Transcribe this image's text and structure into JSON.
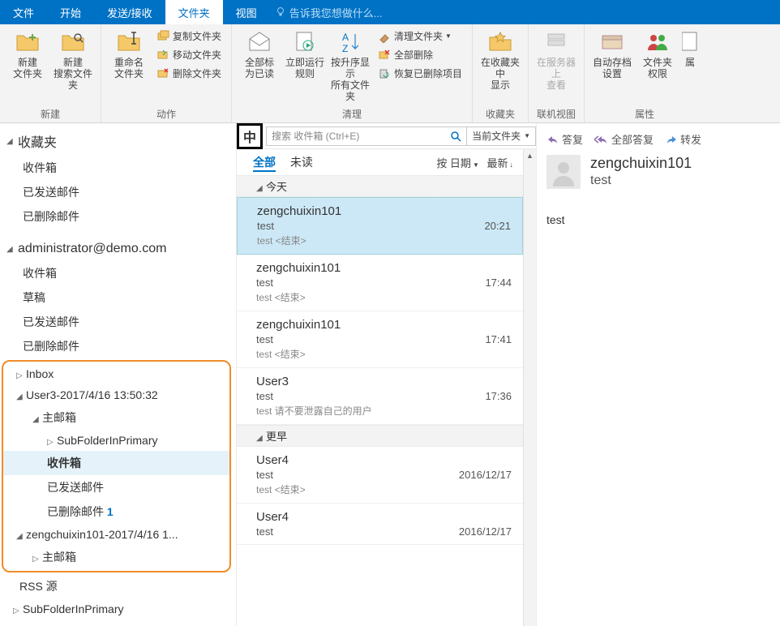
{
  "menu": {
    "file": "文件",
    "home": "开始",
    "sendrecv": "发送/接收",
    "folder": "文件夹",
    "view": "视图",
    "tell": "告诉我您想做什么..."
  },
  "ribbon": {
    "g_new": "新建",
    "new_folder": "新建\n文件夹",
    "new_search_folder": "新建\n搜索文件夹",
    "g_actions": "动作",
    "rename": "重命名\n文件夹",
    "copy_folder": "复制文件夹",
    "move_folder": "移动文件夹",
    "delete_folder": "删除文件夹",
    "g_clean": "清理",
    "mark_read": "全部标\n为已读",
    "run_rules": "立即运行\n规则",
    "show_all": "按升序显示\n所有文件夹",
    "clean_folder": "清理文件夹",
    "delete_all": "全部删除",
    "recover": "恢复已删除项目",
    "g_fav": "收藏夹",
    "show_fav": "在收藏夹中\n显示",
    "g_online": "联机视图",
    "server_view": "在服务器上\n查看",
    "g_prop": "属性",
    "autoarchive": "自动存档\n设置",
    "perm": "文件夹\n权限",
    "fprop": "属"
  },
  "nav": {
    "favorites": "收藏夹",
    "inbox": "收件箱",
    "sent": "已发送邮件",
    "deleted": "已删除邮件",
    "account": "administrator@demo.com",
    "drafts": "草稿",
    "inbox_en": "Inbox",
    "user3": "User3-2017/4/16 13:50:32",
    "primary": "主邮箱",
    "subfolder": "SubFolderInPrimary",
    "deleted_count": "1",
    "zeng": "zengchuixin101-2017/4/16 1...",
    "rss": "RSS 源"
  },
  "mid": {
    "badge": "中",
    "search_ph": "搜索 收件箱 (Ctrl+E)",
    "scope": "当前文件夹",
    "filter_all": "全部",
    "filter_unread": "未读",
    "sort": "按 日期",
    "newest": "最新",
    "grp_today": "今天",
    "grp_earlier": "更早",
    "msgs": [
      {
        "from": "zengchuixin101",
        "subj": "test",
        "time": "20:21",
        "preview": "test <结束>"
      },
      {
        "from": "zengchuixin101",
        "subj": "test",
        "time": "17:44",
        "preview": "test <结束>"
      },
      {
        "from": "zengchuixin101",
        "subj": "test",
        "time": "17:41",
        "preview": "test <结束>"
      },
      {
        "from": "User3",
        "subj": "test",
        "time": "17:36",
        "preview": "test 请不要泄露自己的用户"
      },
      {
        "from": "User4",
        "subj": "test",
        "time": "2016/12/17",
        "preview": "test <结束>"
      },
      {
        "from": "User4",
        "subj": "test",
        "time": "2016/12/17",
        "preview": ""
      }
    ]
  },
  "reading": {
    "reply": "答复",
    "reply_all": "全部答复",
    "forward": "转发",
    "from": "zengchuixin101",
    "subject": "test",
    "body": "test"
  }
}
